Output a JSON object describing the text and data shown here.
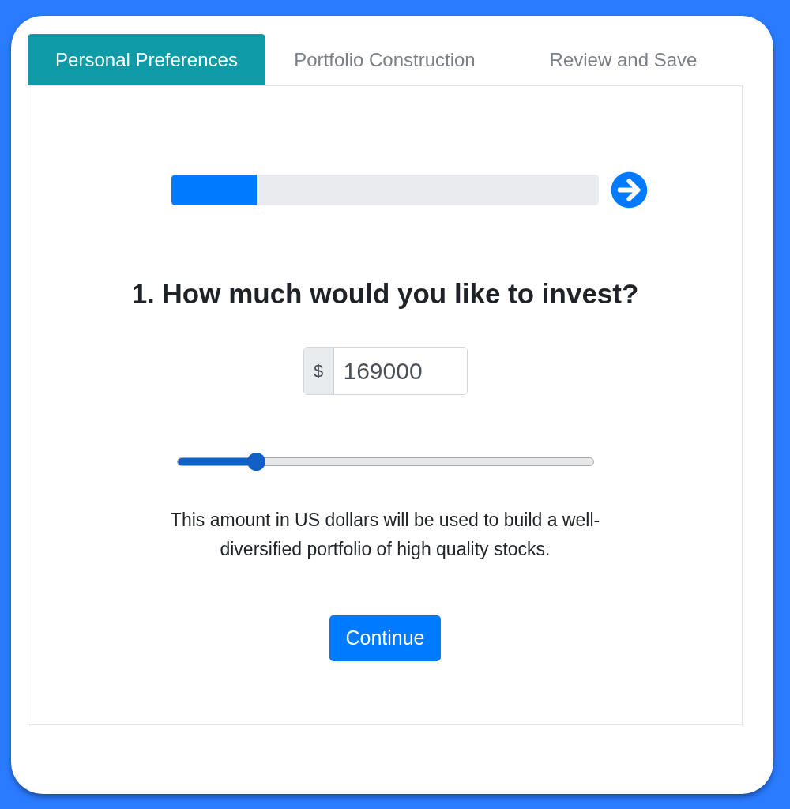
{
  "tabs": [
    {
      "label": "Personal Preferences",
      "selected": true
    },
    {
      "label": "Portfolio Construction",
      "selected": false
    },
    {
      "label": "Review and Save",
      "selected": false
    }
  ],
  "progress": {
    "level": 0.2
  },
  "question": {
    "title": "1. How much would you like to invest?"
  },
  "amount_field": {
    "prefix": "$",
    "value": "169000"
  },
  "amount_slider": {
    "level": 0.19
  },
  "description": "This amount in US dollars will be used to build a well-diversified portfolio of high quality stocks.",
  "buttons": [
    {
      "label": "Continue"
    }
  ]
}
